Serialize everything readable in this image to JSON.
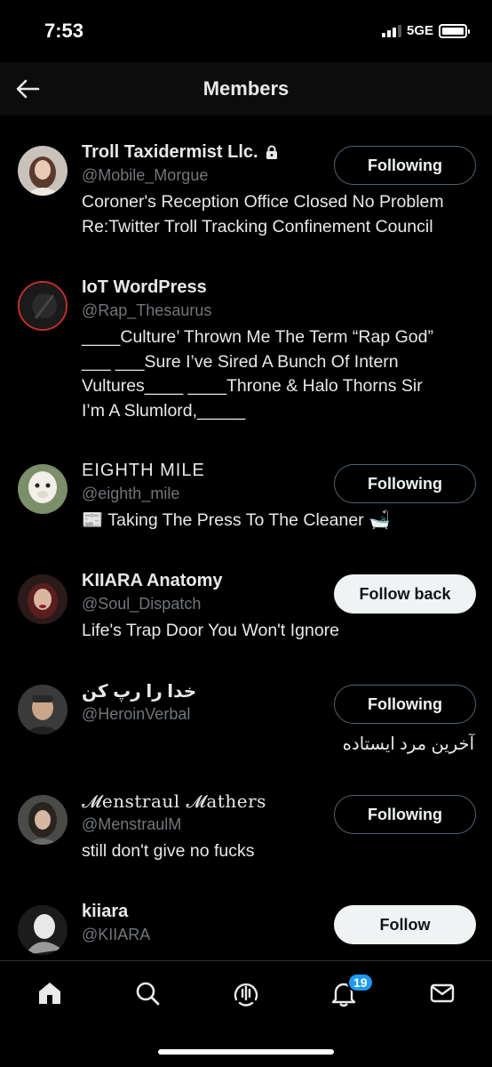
{
  "status_bar": {
    "time": "7:53",
    "network": "5GE"
  },
  "header": {
    "title": "Members",
    "back_icon": "arrow-left-icon"
  },
  "members": [
    {
      "name": "Troll Taxidermist Llc.",
      "locked": true,
      "handle": "@Mobile_Morgue",
      "bio_lines": [
        "Coroner's Reception Office Closed No Problem",
        "Re:Twitter Troll Tracking Confinement Council"
      ],
      "button": "Following",
      "button_style": "outline"
    },
    {
      "name": "IoT WordPress",
      "handle": "@Rap_Thesaurus",
      "bio_lines": [
        "____Culture’ Thrown Me The Term “Rap God”",
        "___ ___Sure I’ve Sired A Bunch Of Intern",
        "Vultures____ ____Throne & Halo Thorns Sir",
        "I’m A Slumlord,_____"
      ]
    },
    {
      "name": "EIGHTH MILE",
      "handle": "@eighth_mile",
      "bio_lines": [
        "📰 Taking The Press To The Cleaner 🛁"
      ],
      "button": "Following",
      "button_style": "outline"
    },
    {
      "name": "KIIARA Anatomy",
      "handle": "@Soul_Dispatch",
      "bio_lines": [
        "Life's Trap Door You Won't Ignore"
      ],
      "button": "Follow back",
      "button_style": "solid"
    },
    {
      "name": "خدا را رپ کن",
      "handle": "@HeroinVerbal",
      "bio_lines": [
        "آخرین مرد ایستاده"
      ],
      "button": "Following",
      "button_style": "outline"
    },
    {
      "name": "𝓜enstraul 𝓜athers",
      "handle": "@MenstraulM",
      "bio_lines": [
        "still don't give no fucks"
      ],
      "button": "Following",
      "button_style": "outline"
    },
    {
      "name": "kiiara",
      "handle": "@KIIARA",
      "bio_lines": [],
      "button": "Follow",
      "button_style": "solid"
    }
  ],
  "tabbar": {
    "items": [
      "home-icon",
      "search-icon",
      "spaces-icon",
      "notifications-icon",
      "messages-icon"
    ],
    "notifications_badge": "19"
  },
  "colors": {
    "background": "#000000",
    "secondary_text": "#71767b",
    "accent": "#1d9bf0"
  }
}
